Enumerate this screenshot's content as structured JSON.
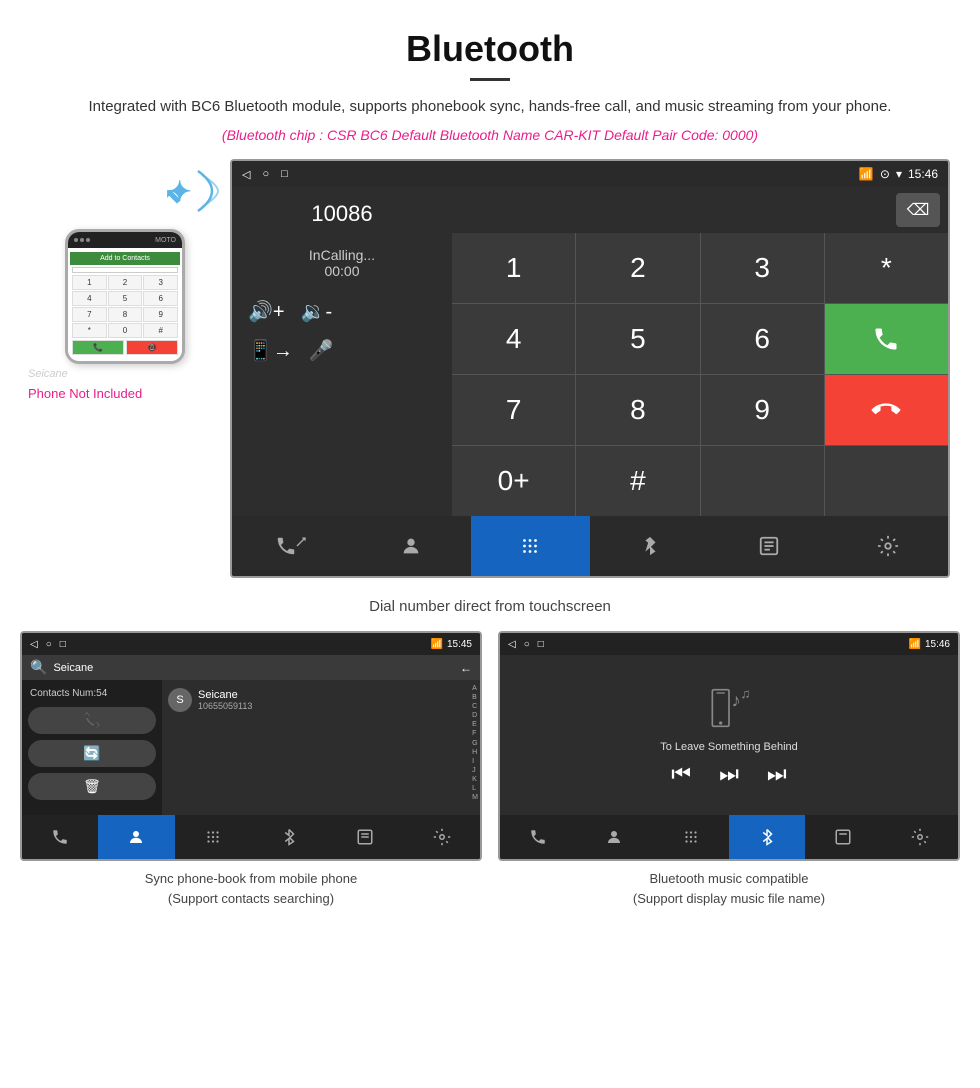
{
  "header": {
    "title": "Bluetooth",
    "divider": true,
    "description": "Integrated with BC6 Bluetooth module, supports phonebook sync, hands-free call, and music streaming from your phone.",
    "specs": "(Bluetooth chip : CSR BC6    Default Bluetooth Name CAR-KIT    Default Pair Code: 0000)"
  },
  "phone_mockup": {
    "watermark": "Seicane",
    "not_included": "Phone Not Included",
    "add_to_contacts": "Add to Contacts",
    "keys": [
      "1",
      "2",
      "3",
      "4",
      "5",
      "6",
      "7",
      "8",
      "9",
      "*",
      "0",
      "#"
    ]
  },
  "main_screen": {
    "statusbar": {
      "back_icon": "◁",
      "home_icon": "○",
      "recent_icon": "□",
      "signal_icons": "📶",
      "time": "15:46"
    },
    "dialer": {
      "number": "10086",
      "status": "InCalling...",
      "timer": "00:00",
      "keys": [
        "1",
        "2",
        "3",
        "*",
        "4",
        "5",
        "6",
        "0+",
        "7",
        "8",
        "9",
        "#"
      ],
      "call_icon": "📞",
      "end_icon": "📞"
    },
    "navbar": {
      "items": [
        {
          "icon": "📞",
          "label": "phone",
          "active": false
        },
        {
          "icon": "👤",
          "label": "contacts",
          "active": false
        },
        {
          "icon": "⠿",
          "label": "dialpad",
          "active": true
        },
        {
          "icon": "✱",
          "label": "bluetooth",
          "active": false
        },
        {
          "icon": "📋",
          "label": "history",
          "active": false
        },
        {
          "icon": "⚙",
          "label": "settings",
          "active": false
        }
      ]
    }
  },
  "main_caption": "Dial number direct from touchscreen",
  "contacts_screen": {
    "statusbar_time": "15:45",
    "contacts_num": "Contacts Num:54",
    "search_placeholder": "Seicane",
    "contact_phone": "10655059113",
    "alpha": [
      "A",
      "B",
      "C",
      "D",
      "E",
      "F",
      "G",
      "H",
      "I",
      "J",
      "K",
      "L",
      "M"
    ],
    "buttons": [
      "📞",
      "🔄",
      "🗑"
    ]
  },
  "music_screen": {
    "statusbar_time": "15:46",
    "song_title": "To Leave Something Behind",
    "controls": [
      "⏮",
      "⏭",
      "⏭"
    ]
  },
  "contacts_caption": {
    "line1": "Sync phone-book from mobile phone",
    "line2": "(Support contacts searching)"
  },
  "music_caption": {
    "line1": "Bluetooth music compatible",
    "line2": "(Support display music file name)"
  }
}
